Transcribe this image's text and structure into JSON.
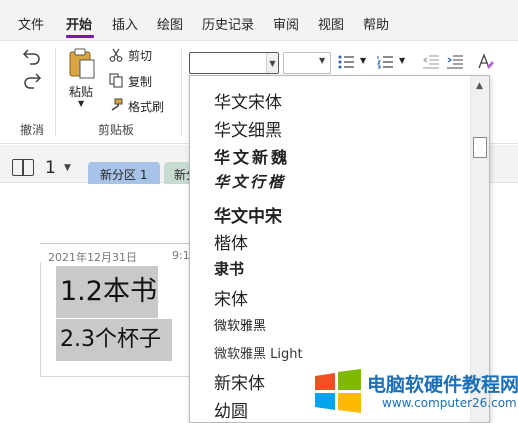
{
  "menu": {
    "items": [
      "文件",
      "开始",
      "插入",
      "绘图",
      "历史记录",
      "审阅",
      "视图",
      "帮助"
    ],
    "active_index": 1
  },
  "ribbon": {
    "undo_group_label": "撤消",
    "clipboard": {
      "paste_label": "粘贴",
      "cut_label": "剪切",
      "copy_label": "复制",
      "format_painter_label": "格式刷",
      "group_label": "剪贴板"
    },
    "font_name_value": "",
    "font_size_value": ""
  },
  "sections": {
    "page_count": "1",
    "tabs": [
      {
        "label": "新分区 1",
        "color": "#a8c3e8"
      },
      {
        "label": "新分",
        "color": "#c7dcd1"
      }
    ]
  },
  "note": {
    "date": "2021年12月31日",
    "time": "9:1",
    "lines": [
      "1.2本书",
      "2.3个杯子"
    ]
  },
  "font_list": {
    "items": [
      "华文宋体",
      "华文细黑",
      "华文新魏",
      "华文行楷",
      "华文中宋",
      "楷体",
      "隶书",
      "宋体",
      "微软雅黑",
      "微软雅黑 Light",
      "新宋体",
      "幼圆"
    ]
  },
  "watermark": {
    "title": "电脑软硬件教程网",
    "url": "www.computer26.com"
  },
  "colors": {
    "accent": "#7719aa",
    "watermark_blue": "#1a6fb8",
    "highlight_gray": "#c9c9c9"
  }
}
